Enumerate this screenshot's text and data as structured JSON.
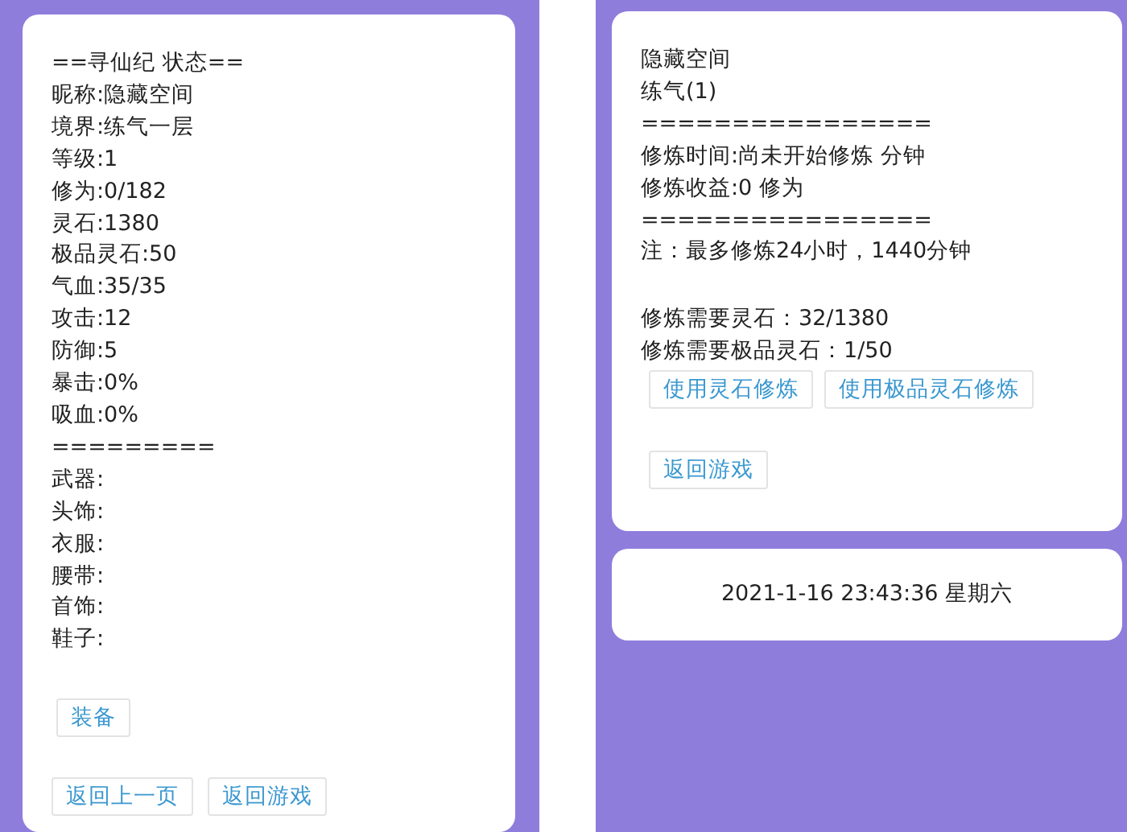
{
  "status_panel": {
    "lines": [
      "==寻仙纪 状态==",
      "昵称:隐藏空间",
      "境界:练气一层",
      "等级:1",
      "修为:0/182",
      "灵石:1380",
      "极品灵石:50",
      "气血:35/35",
      "攻击:12",
      "防御:5",
      "暴击:0%",
      "吸血:0%",
      "=========",
      "武器:",
      "头饰:",
      "衣服:",
      "腰带:",
      "首饰:",
      "鞋子:"
    ],
    "equip_button": "装备",
    "nav_buttons": [
      "返回上一页",
      "返回游戏"
    ]
  },
  "cultivation_panel": {
    "info_lines": [
      "隐藏空间",
      "练气(1)",
      "================",
      "修炼时间:尚未开始修炼 分钟",
      "修炼收益:0 修为",
      "================",
      "注：最多修炼24小时，1440分钟"
    ],
    "cost_lines": [
      "修炼需要灵石：32/1380",
      "修炼需要极品灵石：1/50"
    ],
    "action_buttons": [
      "使用灵石修炼",
      "使用极品灵石修炼"
    ],
    "back_button": "返回游戏"
  },
  "clock": {
    "datetime": "2021-1-16 23:43:36 星期六"
  }
}
